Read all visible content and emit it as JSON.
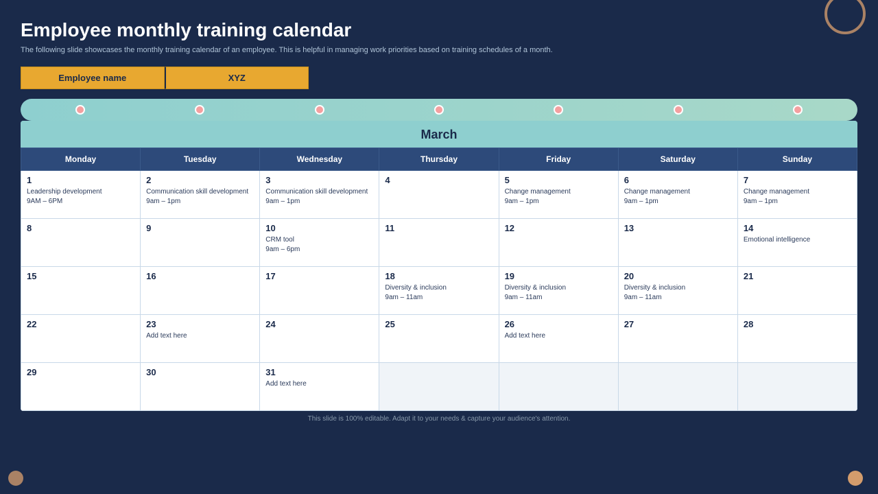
{
  "title": "Employee monthly training calendar",
  "subtitle": "The following slide showcases the monthly training calendar of an employee. This is helpful in managing  work priorities based on training schedules of a month.",
  "employee_label": "Employee name",
  "employee_value": "XYZ",
  "month": "March",
  "days_of_week": [
    "Monday",
    "Tuesday",
    "Wednesday",
    "Thursday",
    "Friday",
    "Saturday",
    "Sunday"
  ],
  "weeks": [
    [
      {
        "date": "1",
        "event": "Leadership development\n9AM – 6PM"
      },
      {
        "date": "2",
        "event": "Communication skill development\n9am – 1pm"
      },
      {
        "date": "3",
        "event": "Communication skill development\n9am – 1pm"
      },
      {
        "date": "4",
        "event": ""
      },
      {
        "date": "5",
        "event": "Change management\n9am – 1pm"
      },
      {
        "date": "6",
        "event": "Change management\n9am – 1pm"
      },
      {
        "date": "7",
        "event": "Change management\n9am – 1pm"
      }
    ],
    [
      {
        "date": "8",
        "event": ""
      },
      {
        "date": "9",
        "event": ""
      },
      {
        "date": "10",
        "event": "CRM tool\n9am – 6pm"
      },
      {
        "date": "11",
        "event": ""
      },
      {
        "date": "12",
        "event": ""
      },
      {
        "date": "13",
        "event": ""
      },
      {
        "date": "14",
        "event": "Emotional intelligence"
      }
    ],
    [
      {
        "date": "15",
        "event": ""
      },
      {
        "date": "16",
        "event": ""
      },
      {
        "date": "17",
        "event": ""
      },
      {
        "date": "18",
        "event": "Diversity & inclusion\n9am – 11am"
      },
      {
        "date": "19",
        "event": "Diversity & inclusion\n9am – 11am"
      },
      {
        "date": "20",
        "event": "Diversity & inclusion\n9am – 11am"
      },
      {
        "date": "21",
        "event": ""
      }
    ],
    [
      {
        "date": "22",
        "event": ""
      },
      {
        "date": "23",
        "event": "Add text here"
      },
      {
        "date": "24",
        "event": ""
      },
      {
        "date": "25",
        "event": ""
      },
      {
        "date": "26",
        "event": "Add text here"
      },
      {
        "date": "27",
        "event": ""
      },
      {
        "date": "28",
        "event": ""
      }
    ],
    [
      {
        "date": "29",
        "event": ""
      },
      {
        "date": "30",
        "event": ""
      },
      {
        "date": "31",
        "event": "Add text here"
      },
      {
        "date": "",
        "event": ""
      },
      {
        "date": "",
        "event": ""
      },
      {
        "date": "",
        "event": ""
      },
      {
        "date": "",
        "event": ""
      }
    ]
  ],
  "footer": "This slide is 100% editable.  Adapt it to your needs & capture your audience's attention."
}
